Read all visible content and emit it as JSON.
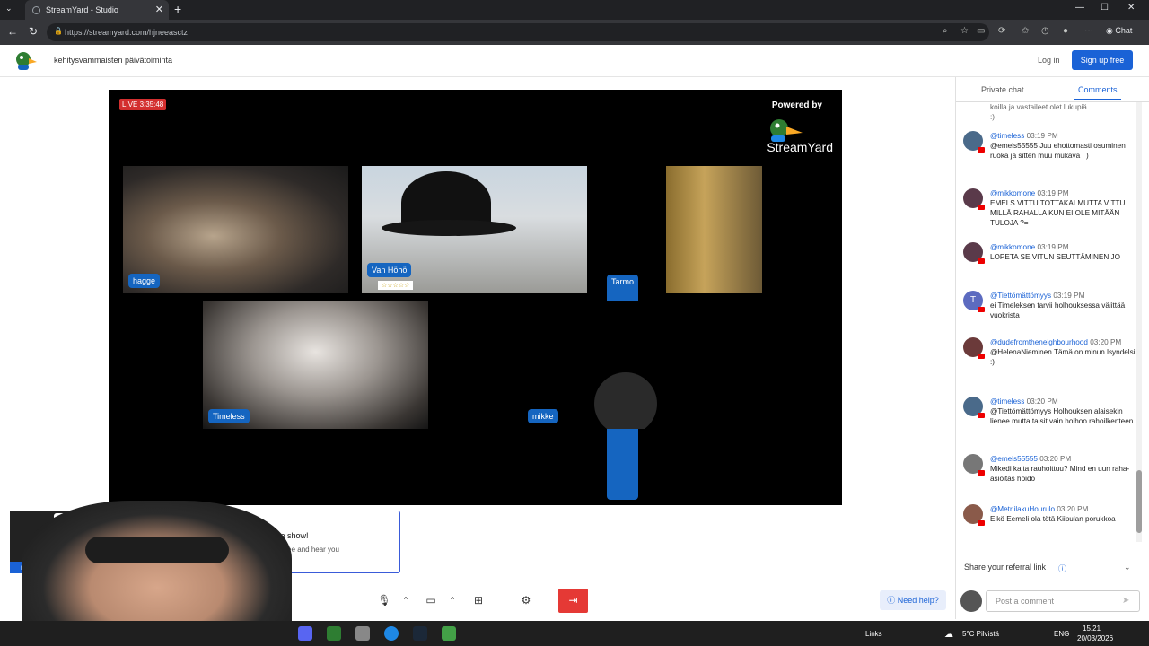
{
  "browser": {
    "tab_title": "StreamYard - Studio",
    "url": "https://streamyard.com/hjneeasctz",
    "chat_label": "Chat"
  },
  "site": {
    "title": "kehitysvammaisten päivätoiminta",
    "login": "Log in",
    "signup": "Sign up free"
  },
  "stage": {
    "live_badge": "LIVE 3:35:48",
    "powered_by": "Powered by",
    "brand": "StreamYard",
    "participants": [
      {
        "name": "hagge"
      },
      {
        "name": "Van Höhö",
        "stars": "☆☆☆☆☆"
      },
      {
        "name": "Tarmo"
      },
      {
        "name": "Timeless"
      },
      {
        "name": "mikke"
      }
    ]
  },
  "self_preview": {
    "name": "mikke",
    "controls": "··· 🎤 ⋮"
  },
  "join_prompt": {
    "title": "the show!",
    "subtitle": "on see and hear you"
  },
  "controls": {
    "need_help": "Need help?"
  },
  "panel": {
    "tabs": [
      "Private chat",
      "Comments"
    ],
    "active_tab": "Comments",
    "top_fragment": "koilla ja vastaileet olet lukupiä\n:)",
    "comments": [
      {
        "author": "@timeless",
        "time": "03:19 PM",
        "text": "@emels55555 Juu ehottomasti osuminen ruoka ja sitten muu mukava : )",
        "avatar_color": "#4a6a8a"
      },
      {
        "author": "@mikkomone",
        "time": "03:19 PM",
        "text": "EMELS VITTU TOTTAKAI MUTTA VITTU MILLÄ RAHALLA KUN EI OLE MITÄÄN TULOJA ?=",
        "avatar_color": "#5a3a4a"
      },
      {
        "author": "@mikkomone",
        "time": "03:19 PM",
        "text": "LOPETA SE VITUN SEUTTÄMINEN JO",
        "avatar_color": "#5a3a4a"
      },
      {
        "author": "@Tiettömättömyys",
        "time": "03:19 PM",
        "text": "ei Timeleksen tarvii holhouksessa välittää vuokrista",
        "avatar_color": "#5c6bc0",
        "initial": "T"
      },
      {
        "author": "@dudefromtheneighbourhood",
        "time": "03:20 PM",
        "text": "@HelenaNieminen Tämä on minun lsyndelsiisi :)",
        "avatar_color": "#6b3a3a"
      },
      {
        "author": "@timeless",
        "time": "03:20 PM",
        "text": "@Tiettömättömyys Holhouksen alaisekin lienee mutta taisit vain holhoo rahoilkenteen : )",
        "avatar_color": "#4a6a8a"
      },
      {
        "author": "@emels55555",
        "time": "03:20 PM",
        "text": "Mikedi kaita rauhoittuu? Mind en uun raha-asioitas hoido",
        "avatar_color": "#777777"
      },
      {
        "author": "@MetriilakuHourulo",
        "time": "03:20 PM",
        "text": "Eikö Eemeli ola tötä Kiipulan porukkoa",
        "avatar_color": "#8a5a4a"
      }
    ],
    "referral": "Share your referral link",
    "comment_placeholder": "Post a comment"
  },
  "taskbar": {
    "links": "Links",
    "weather": "5°C Pilvistä",
    "lang": "ENG",
    "time": "15.21",
    "date": "20/03/2026"
  }
}
